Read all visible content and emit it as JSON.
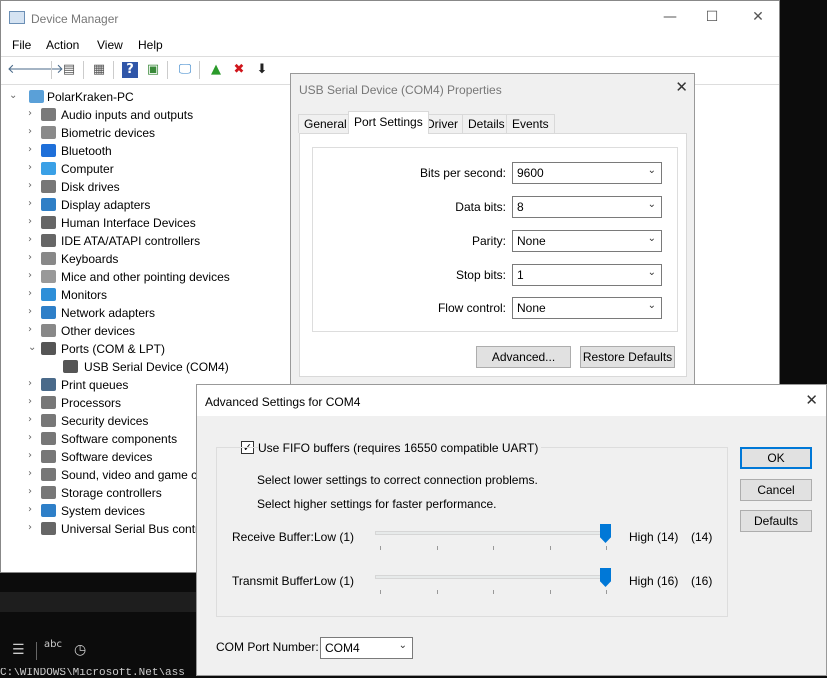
{
  "device_manager": {
    "title": "Device Manager",
    "menu": [
      "File",
      "Action",
      "View",
      "Help"
    ],
    "root": "PolarKraken-PC",
    "tree": [
      {
        "label": "Audio inputs and outputs",
        "icon": "speaker-icon",
        "color": "#7a7a7a"
      },
      {
        "label": "Biometric devices",
        "icon": "fingerprint-icon",
        "color": "#8a8a8a"
      },
      {
        "label": "Bluetooth",
        "icon": "bluetooth-icon",
        "color": "#1e6fd9"
      },
      {
        "label": "Computer",
        "icon": "computer-icon",
        "color": "#3aa0e6"
      },
      {
        "label": "Disk drives",
        "icon": "disk-drive-icon",
        "color": "#777777"
      },
      {
        "label": "Display adapters",
        "icon": "display-adapter-icon",
        "color": "#2f7fc6"
      },
      {
        "label": "Human Interface Devices",
        "icon": "hid-icon",
        "color": "#666666"
      },
      {
        "label": "IDE ATA/ATAPI controllers",
        "icon": "ide-controller-icon",
        "color": "#666666"
      },
      {
        "label": "Keyboards",
        "icon": "keyboard-icon",
        "color": "#888888"
      },
      {
        "label": "Mice and other pointing devices",
        "icon": "mouse-icon",
        "color": "#999999"
      },
      {
        "label": "Monitors",
        "icon": "monitor-icon",
        "color": "#2e8fd8"
      },
      {
        "label": "Network adapters",
        "icon": "network-adapter-icon",
        "color": "#2e7fc8"
      },
      {
        "label": "Other devices",
        "icon": "other-devices-icon",
        "color": "#888888"
      },
      {
        "label": "Ports (COM & LPT)",
        "icon": "port-icon",
        "color": "#555555",
        "expanded": true
      },
      {
        "label": "USB Serial Device (COM4)",
        "icon": "port-icon",
        "color": "#555555",
        "child": true
      },
      {
        "label": "Print queues",
        "icon": "printer-icon",
        "color": "#4a6a8a"
      },
      {
        "label": "Processors",
        "icon": "processor-icon",
        "color": "#777777"
      },
      {
        "label": "Security devices",
        "icon": "security-device-icon",
        "color": "#777777"
      },
      {
        "label": "Software components",
        "icon": "software-component-icon",
        "color": "#777777"
      },
      {
        "label": "Software devices",
        "icon": "software-device-icon",
        "color": "#777777"
      },
      {
        "label": "Sound, video and game controllers",
        "icon": "sound-icon",
        "color": "#777777"
      },
      {
        "label": "Storage controllers",
        "icon": "storage-icon",
        "color": "#777777"
      },
      {
        "label": "System devices",
        "icon": "system-device-icon",
        "color": "#2e7fc8"
      },
      {
        "label": "Universal Serial Bus controllers",
        "icon": "usb-icon",
        "color": "#666666"
      }
    ]
  },
  "properties": {
    "title": "USB Serial Device (COM4) Properties",
    "tabs": [
      "General",
      "Port Settings",
      "Driver",
      "Details",
      "Events"
    ],
    "selected_tab": "Port Settings",
    "fields": [
      {
        "label": "Bits per second:",
        "value": "9600"
      },
      {
        "label": "Data bits:",
        "value": "8"
      },
      {
        "label": "Parity:",
        "value": "None"
      },
      {
        "label": "Stop bits:",
        "value": "1"
      },
      {
        "label": "Flow control:",
        "value": "None"
      }
    ],
    "advanced_label": "Advanced...",
    "restore_label": "Restore Defaults"
  },
  "advanced": {
    "title": "Advanced Settings for COM4",
    "fifo_label": "Use FIFO buffers (requires 16550 compatible UART)",
    "fifo_checked": true,
    "hint1": "Select lower settings to correct connection problems.",
    "hint2": "Select higher settings for faster performance.",
    "receive": {
      "label": "Receive Buffer:",
      "low": "Low (1)",
      "high": "High (14)",
      "value": "(14)",
      "level": 1.0
    },
    "transmit": {
      "label": "Transmit Buffer:",
      "low": "Low (1)",
      "high": "High (16)",
      "value": "(16)",
      "level": 1.0
    },
    "com_label": "COM Port Number:",
    "com_value": "COM4",
    "ok": "OK",
    "cancel": "Cancel",
    "defaults": "Defaults"
  },
  "terminal": {
    "line": "C:\\WINDOWS\\Microsoft.Net\\ass"
  }
}
